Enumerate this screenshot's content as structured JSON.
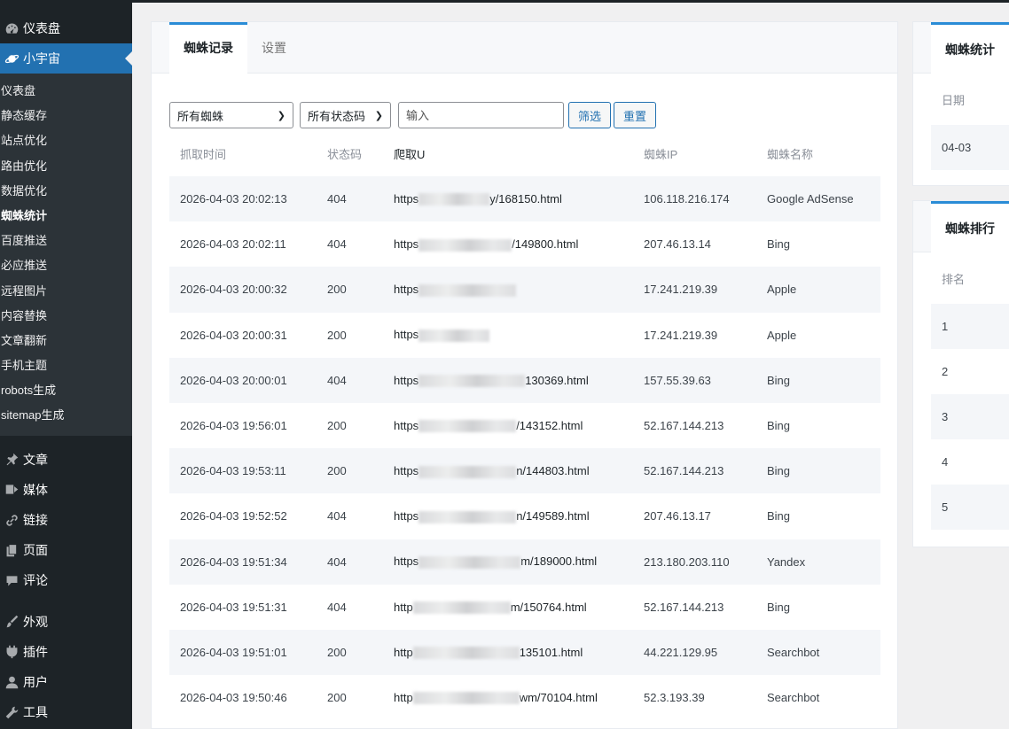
{
  "sidebar": {
    "dashboard": "仪表盘",
    "plugin": "小宇宙",
    "sub_items": [
      "仪表盘",
      "静态缓存",
      "站点优化",
      "路由优化",
      "数据优化",
      "蜘蛛统计",
      "百度推送",
      "必应推送",
      "远程图片",
      "内容替换",
      "文章翻新",
      "手机主题",
      "robots生成",
      "sitemap生成"
    ],
    "current_sub": 5,
    "lower_items": [
      {
        "label": "文章",
        "icon": "pin-icon"
      },
      {
        "label": "媒体",
        "icon": "media-icon"
      },
      {
        "label": "链接",
        "icon": "link-icon"
      },
      {
        "label": "页面",
        "icon": "page-icon"
      },
      {
        "label": "评论",
        "icon": "comment-icon"
      },
      {
        "label": "外观",
        "icon": "brush-icon"
      },
      {
        "label": "插件",
        "icon": "plugin-icon"
      },
      {
        "label": "用户",
        "icon": "user-icon"
      },
      {
        "label": "工具",
        "icon": "wrench-icon"
      }
    ]
  },
  "main": {
    "tabs": [
      "蜘蛛记录",
      "设置"
    ],
    "filters": {
      "spider_select": "所有蜘蛛",
      "status_select": "所有状态码",
      "input_placeholder": "输入",
      "filter_btn": "筛选",
      "reset_btn": "重置"
    },
    "columns": [
      "抓取时间",
      "状态码",
      "爬取U",
      "蜘蛛IP",
      "蜘蛛名称"
    ],
    "rows": [
      {
        "time": "2026-04-03 20:02:13",
        "code": "404",
        "url_prefix": "https",
        "url_suffix": "y/168150.html",
        "ip": "106.118.216.174",
        "name": "Google AdSense"
      },
      {
        "time": "2026-04-03 20:02:11",
        "code": "404",
        "url_prefix": "https",
        "url_suffix": "/149800.html",
        "ip": "207.46.13.14",
        "name": "Bing"
      },
      {
        "time": "2026-04-03 20:00:32",
        "code": "200",
        "url_prefix": "https",
        "url_suffix": "",
        "ip": "17.241.219.39",
        "name": "Apple"
      },
      {
        "time": "2026-04-03 20:00:31",
        "code": "200",
        "url_prefix": "https",
        "url_suffix": "",
        "ip": "17.241.219.39",
        "name": "Apple"
      },
      {
        "time": "2026-04-03 20:00:01",
        "code": "404",
        "url_prefix": "https",
        "url_suffix": "130369.html",
        "ip": "157.55.39.63",
        "name": "Bing"
      },
      {
        "time": "2026-04-03 19:56:01",
        "code": "200",
        "url_prefix": "https",
        "url_suffix": "/143152.html",
        "ip": "52.167.144.213",
        "name": "Bing"
      },
      {
        "time": "2026-04-03 19:53:11",
        "code": "200",
        "url_prefix": "https",
        "url_suffix": "n/144803.html",
        "ip": "52.167.144.213",
        "name": "Bing"
      },
      {
        "time": "2026-04-03 19:52:52",
        "code": "404",
        "url_prefix": "https",
        "url_suffix": "n/149589.html",
        "ip": "207.46.13.17",
        "name": "Bing"
      },
      {
        "time": "2026-04-03 19:51:34",
        "code": "404",
        "url_prefix": "https",
        "url_suffix": "m/189000.html",
        "ip": "213.180.203.110",
        "name": "Yandex"
      },
      {
        "time": "2026-04-03 19:51:31",
        "code": "404",
        "url_prefix": "http",
        "url_suffix": "m/150764.html",
        "ip": "52.167.144.213",
        "name": "Bing"
      },
      {
        "time": "2026-04-03 19:51:01",
        "code": "200",
        "url_prefix": "http",
        "url_suffix": "135101.html",
        "ip": "44.221.129.95",
        "name": "Searchbot"
      },
      {
        "time": "2026-04-03 19:50:46",
        "code": "200",
        "url_prefix": "http",
        "url_suffix": "wm/70104.html",
        "ip": "52.3.193.39",
        "name": "Searchbot"
      }
    ]
  },
  "right": {
    "stats_tab": "蜘蛛统计",
    "stats_header": "日期",
    "stats_rows": [
      "04-03"
    ],
    "rank_tab": "蜘蛛排行",
    "rank_header": "排名",
    "rank_rows": [
      "1",
      "2",
      "3",
      "4",
      "5"
    ]
  }
}
